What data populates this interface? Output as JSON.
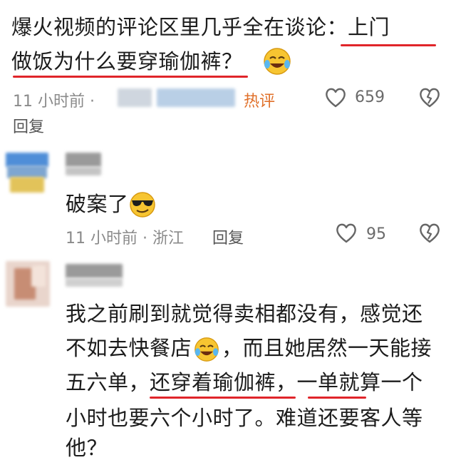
{
  "post": {
    "line1": "爆火视频的评论区里几乎全在谈论：上门",
    "line2": "做饭为什么要穿瑜伽裤？",
    "time": "11 小时前 ·",
    "hot_label": "热评",
    "like_count": "659",
    "reply_label": "回复"
  },
  "comments": [
    {
      "text": "破案了",
      "time": "11 小时前 · 浙江",
      "reply_label": "回复",
      "like_count": "95"
    },
    {
      "line1": "我之前刷到就觉得卖相都没有，感觉还",
      "line2a": "不如去快餐店",
      "line2b": "，而且她居然一天能接",
      "line3": "五六单，还穿着瑜伽裤，一单就算一个",
      "line4": "小时也要六个小时了。难道还要客人等",
      "line5": "他？"
    }
  ],
  "colors": {
    "underline": "#e0252a",
    "hot": "#e0702a",
    "meta": "#8a8a8a"
  }
}
